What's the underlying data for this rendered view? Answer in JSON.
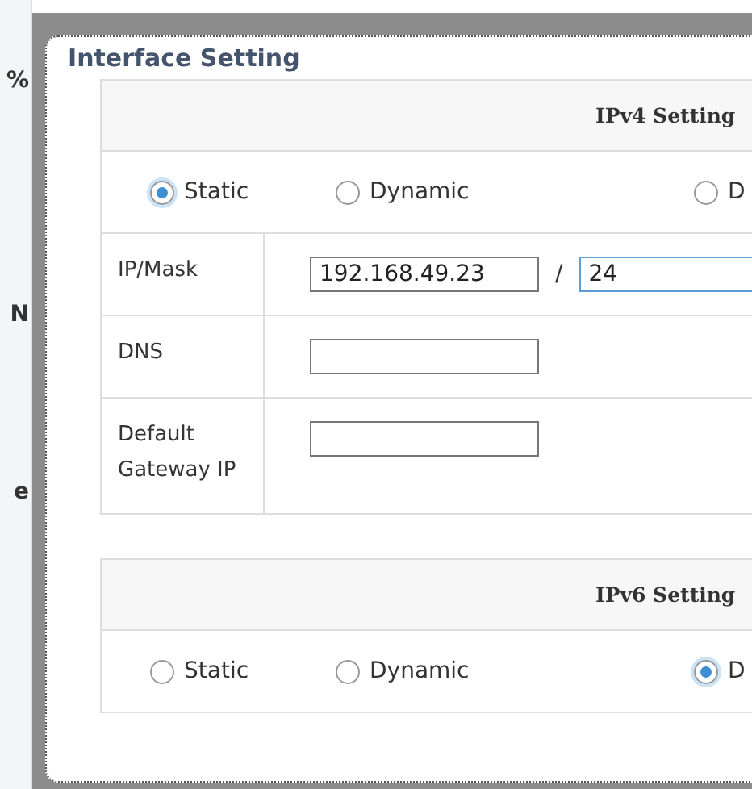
{
  "background_fragments": [
    {
      "text": "%"
    },
    {
      "text": "N"
    },
    {
      "text": "e"
    }
  ],
  "dialog": {
    "title": "Interface Setting",
    "ipv4": {
      "title": "IPv4 Setting",
      "modes": [
        {
          "label": "Static",
          "selected": true
        },
        {
          "label": "Dynamic",
          "selected": false
        },
        {
          "label": "D",
          "selected": false
        }
      ],
      "fields": [
        {
          "label": "IP/Mask",
          "value": "192.168.49.23",
          "separator": "/",
          "mask": "24"
        },
        {
          "label": "DNS"
        },
        {
          "label": "Default Gateway IP"
        }
      ]
    },
    "ipv6": {
      "title": "IPv6 Setting",
      "modes": [
        {
          "label": "Static",
          "selected": false
        },
        {
          "label": "Dynamic",
          "selected": false
        },
        {
          "label": "D",
          "selected": true
        }
      ]
    }
  }
}
